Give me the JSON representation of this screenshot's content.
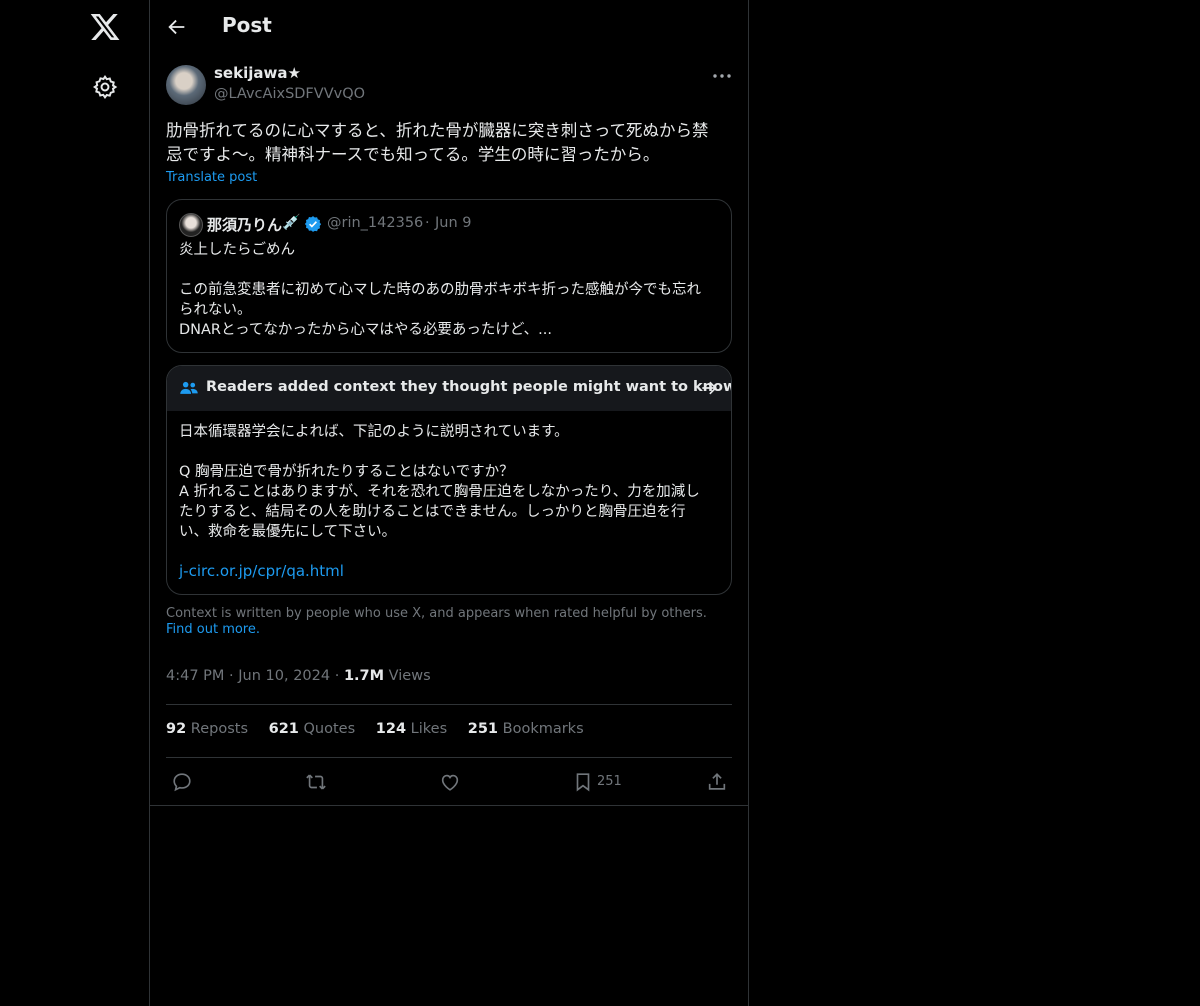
{
  "nav": {
    "logo_icon": "x-logo-icon",
    "settings_icon": "gear-icon"
  },
  "header": {
    "title": "Post",
    "back_icon": "arrow-left-icon"
  },
  "post": {
    "display_name": "sekijawa★",
    "handle": "@LAvcAixSDFVVvQO",
    "text_line1": "肋骨折れてるのに心マすると、折れた骨が臓器に突き刺さって死ぬから禁",
    "text_line2": "忌ですよ〜。精神科ナースでも知ってる。学生の時に習ったから。",
    "translate": "Translate post",
    "time": "4:47 PM",
    "date": "Jun 10, 2024",
    "views_count": "1.7M",
    "views_label": "Views"
  },
  "quote": {
    "name": "那須乃りん",
    "emoji": "💉",
    "handle": "@rin_142356",
    "separator": "·",
    "date": "Jun 9",
    "line1": "炎上したらごめん",
    "line2": "この前急変患者に初めて心マした時のあの肋骨ボキボキ折った感触が今でも忘れ",
    "line3": "られない。",
    "line4": "DNARとってなかったから心マはやる必要あったけど、..."
  },
  "community_note": {
    "title": "Readers added context they thought people might want to know",
    "line1": "日本循環器学会によれば、下記のように説明されています。",
    "line2": "Q 胸骨圧迫で骨が折れたりすることはないですか？",
    "line3": "A 折れることはありますが、それを恐れて胸骨圧迫をしなかったり、力を加減し",
    "line4": "たりすると、結局その人を助けることはできません。しっかりと胸骨圧迫を行",
    "line5": "い、救命を最優先にして下さい。",
    "link": "j-circ.or.jp/cpr/qa.html",
    "footer_text": "Context is written by people who use X, and appears when rated helpful by others.",
    "footer_link": "Find out more."
  },
  "stats": {
    "reposts_count": "92",
    "reposts_label": "Reposts",
    "quotes_count": "621",
    "quotes_label": "Quotes",
    "likes_count": "124",
    "likes_label": "Likes",
    "bookmarks_count": "251",
    "bookmarks_label": "Bookmarks"
  },
  "actions": {
    "bookmark_count": "251"
  },
  "colors": {
    "background": "#000000",
    "text": "#e7e9ea",
    "muted": "#71767b",
    "accent": "#1d9bf0",
    "border": "#2f3336"
  }
}
